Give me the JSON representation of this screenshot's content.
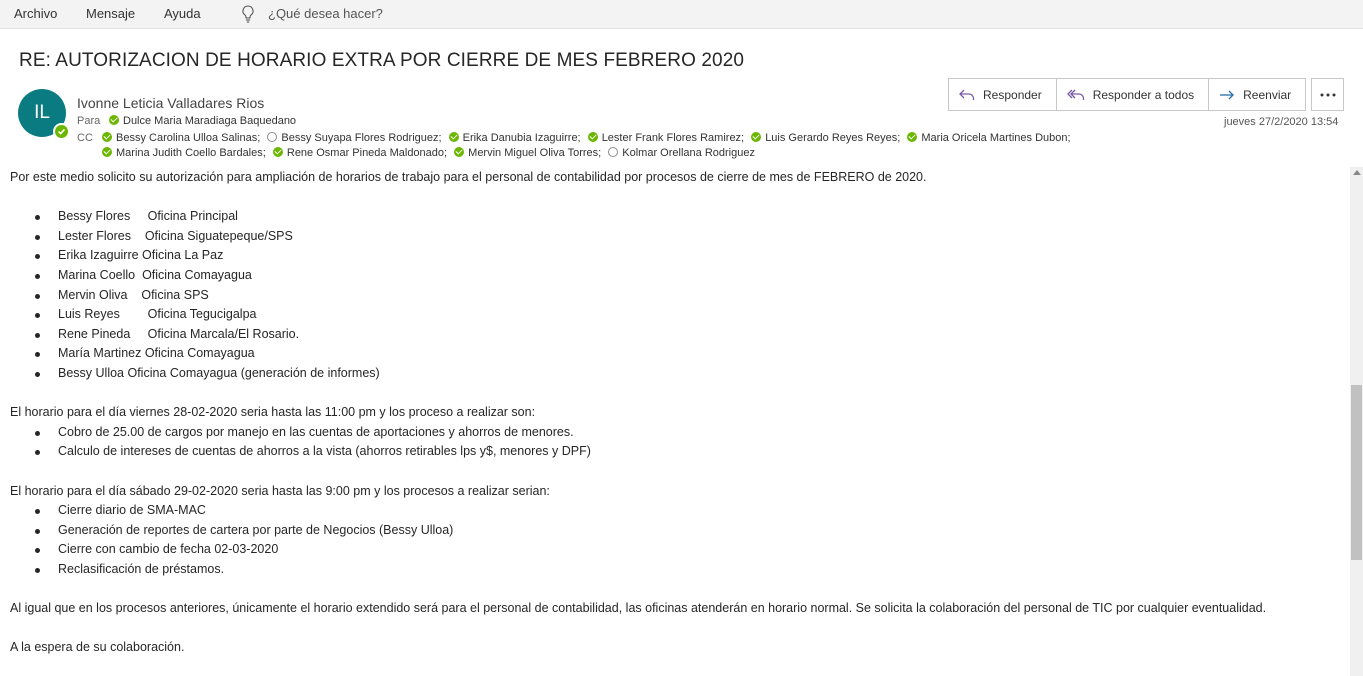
{
  "ribbon": {
    "menu": [
      "Archivo",
      "Mensaje",
      "Ayuda"
    ],
    "tell_me": "¿Qué desea hacer?",
    "tell_me_icon": "lightbulb-icon"
  },
  "email": {
    "subject": "RE: AUTORIZACION DE HORARIO EXTRA POR CIERRE DE MES FEBRERO 2020",
    "avatar_initials": "IL",
    "avatar_color": "#0a7b80",
    "sender": "Ivonne Leticia Valladares Rios",
    "to_label": "Para",
    "to": [
      {
        "name": "Dulce Maria Maradiaga Baquedano",
        "online": true
      }
    ],
    "cc_label": "CC",
    "cc_line1": [
      {
        "name": "Bessy Carolina Ulloa Salinas;",
        "online": true
      },
      {
        "name": "Bessy Suyapa Flores Rodriguez;",
        "online": false
      },
      {
        "name": "Erika Danubia Izaguirre;",
        "online": true
      },
      {
        "name": "Lester Frank Flores Ramirez;",
        "online": true
      },
      {
        "name": "Luis Gerardo Reyes Reyes;",
        "online": true
      },
      {
        "name": "Maria Oricela Martines Dubon;",
        "online": true
      }
    ],
    "cc_line2": [
      {
        "name": "Marina Judith Coello Bardales;",
        "online": true
      },
      {
        "name": "Rene Osmar Pineda Maldonado;",
        "online": true
      },
      {
        "name": "Mervin Miguel Oliva Torres;",
        "online": true
      },
      {
        "name": "Kolmar Orellana Rodriguez",
        "online": false
      }
    ],
    "date": "jueves 27/2/2020 13:54",
    "actions": {
      "reply": "Responder",
      "reply_all": "Responder a todos",
      "forward": "Reenviar",
      "more_icon": "more-icon"
    }
  },
  "body": {
    "intro": "Por este medio solicito su autorización para ampliación de horarios de trabajo para el personal de contabilidad por procesos de cierre de mes de FEBRERO de 2020.",
    "staff": [
      "Bessy Flores     Oficina Principal",
      "Lester Flores    Oficina Siguatepeque/SPS",
      "Erika Izaguirre Oficina La Paz",
      "Marina Coello  Oficina Comayagua",
      "Mervin Oliva    Oficina SPS",
      "Luis Reyes        Oficina Tegucigalpa",
      "Rene Pineda     Oficina Marcala/El Rosario.",
      "María Martinez Oficina Comayagua",
      "Bessy Ulloa Oficina Comayagua (generación de informes)"
    ],
    "friday_intro": "El horario para el día viernes 28-02-2020 seria hasta las 11:00 pm y los proceso a realizar son:",
    "friday_tasks": [
      "Cobro de 25.00 de cargos por manejo en las cuentas de aportaciones y ahorros de menores.",
      "Calculo de intereses de cuentas de ahorros a la vista (ahorros retirables lps y$, menores y DPF)"
    ],
    "saturday_intro": "El horario para el día sábado 29-02-2020 seria hasta las 9:00 pm y los procesos a realizar serian:",
    "saturday_tasks": [
      "Cierre diario de SMA-MAC",
      "Generación de reportes de cartera por parte de Negocios (Bessy Ulloa)",
      "Cierre con cambio de fecha 02-03-2020",
      "Reclasificación de préstamos."
    ],
    "closing": "Al igual que en los procesos anteriores, únicamente el horario extendido será para el personal de contabilidad, las oficinas atenderán en horario normal. Se solicita la colaboración del personal de TIC por cualquier eventualidad.",
    "signoff": "A la espera de su colaboración."
  }
}
